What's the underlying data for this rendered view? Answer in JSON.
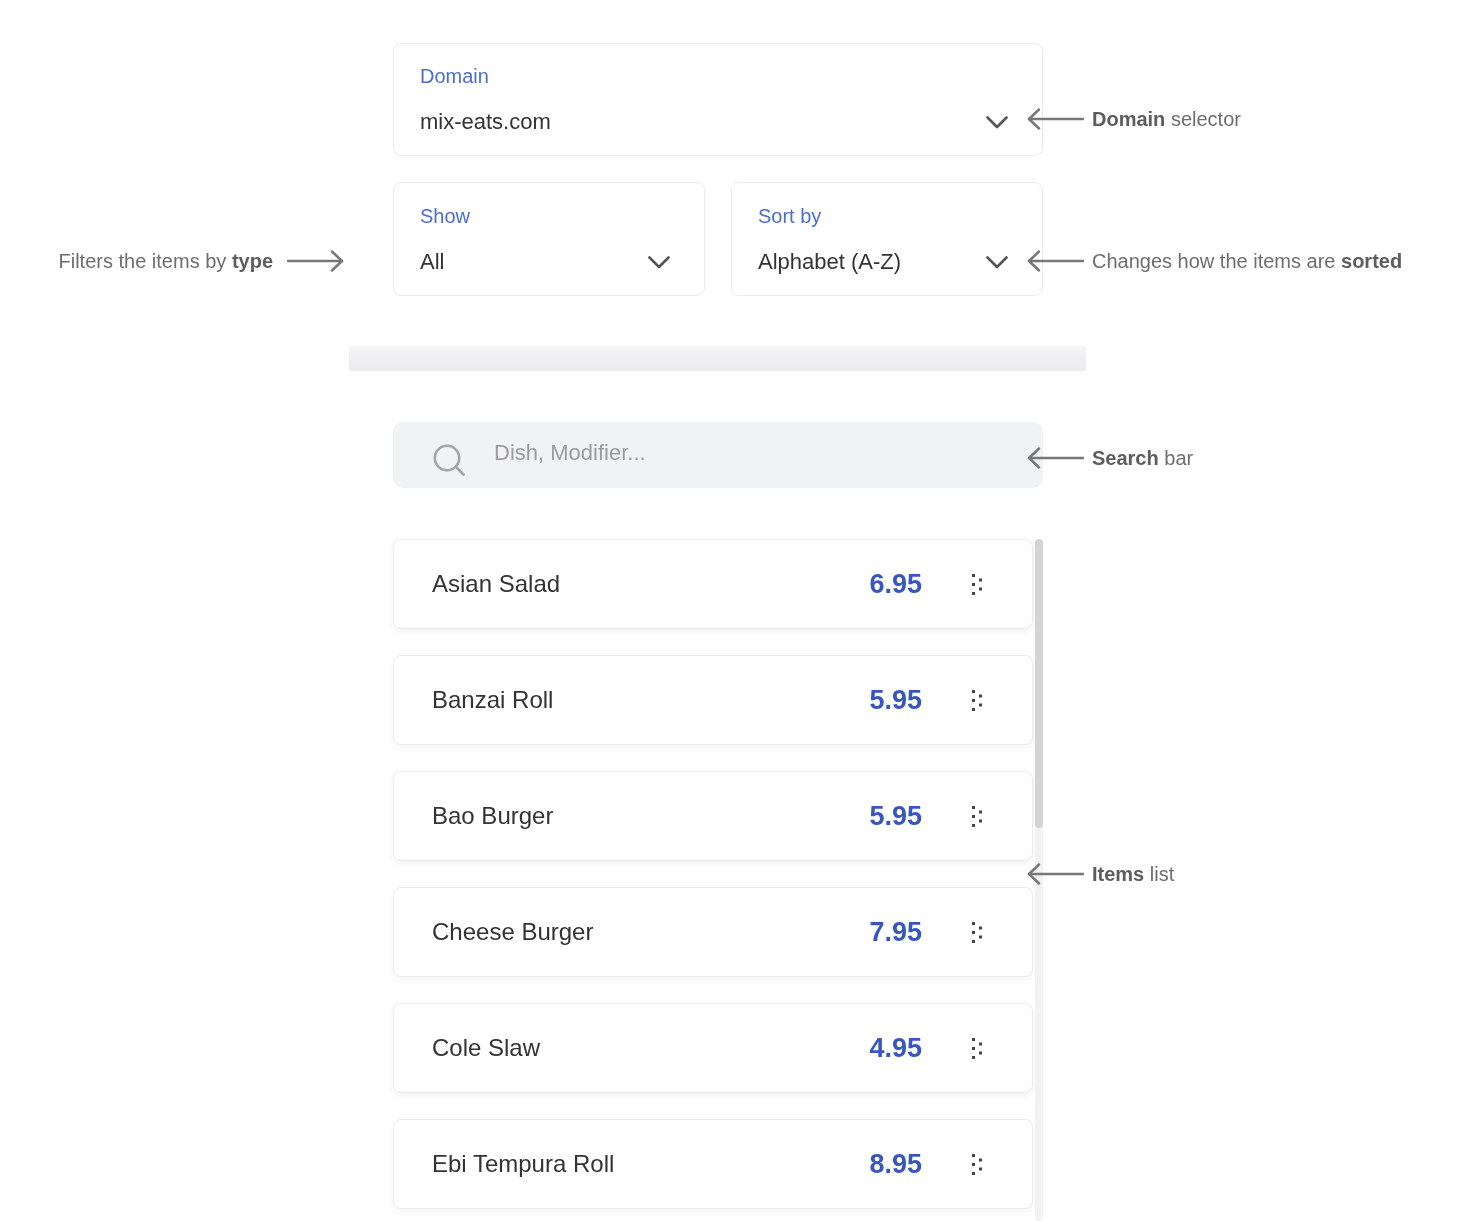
{
  "domain_select": {
    "label": "Domain",
    "value": "mix-eats.com",
    "callout": "**Domain** selector"
  },
  "filter_row": {
    "selects": [
      {
        "label": "Show",
        "value": "All"
      },
      {
        "label": "Sort by",
        "value": "Alphabet (A-Z)"
      }
    ],
    "callout_left": "Filters the items by **type**",
    "callout_right": "Changes how the items are **sorted**"
  },
  "search": {
    "placeholder": "Dish, Modifier...",
    "callout": "**Search** bar"
  },
  "items_list": {
    "items": [
      {
        "name": "Asian Salad",
        "price": "6.95"
      },
      {
        "name": "Banzai Roll",
        "price": "5.95"
      },
      {
        "name": "Bao Burger",
        "price": "5.95"
      },
      {
        "name": "Cheese Burger",
        "price": "7.95"
      },
      {
        "name": "Cole Slaw",
        "price": "4.95"
      },
      {
        "name": "Ebi Tempura Roll",
        "price": "8.95"
      }
    ],
    "callout": "**Items** list"
  }
}
